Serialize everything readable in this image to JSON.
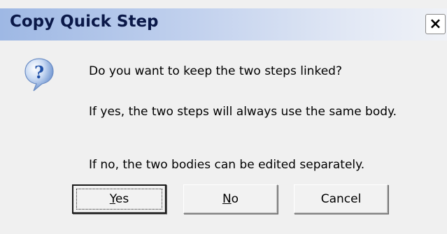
{
  "dialog": {
    "title": "Copy Quick Step",
    "close_label": "×",
    "icon": "question-icon",
    "messages": [
      "Do you want to keep the two steps linked?",
      "If yes, the two steps will always use the same body.",
      "If no, the two bodies can be edited separately."
    ],
    "buttons": {
      "yes": {
        "mnemonic": "Y",
        "rest": "es"
      },
      "no": {
        "mnemonic": "N",
        "rest": "o"
      },
      "cancel": {
        "label": "Cancel"
      }
    },
    "colors": {
      "titlebar_start": "#9eb8e4",
      "titlebar_end": "#f0f2f7",
      "title_text": "#0a1848",
      "body_bg": "#f0f0f0",
      "icon_blue": "#2b5fb5"
    }
  }
}
